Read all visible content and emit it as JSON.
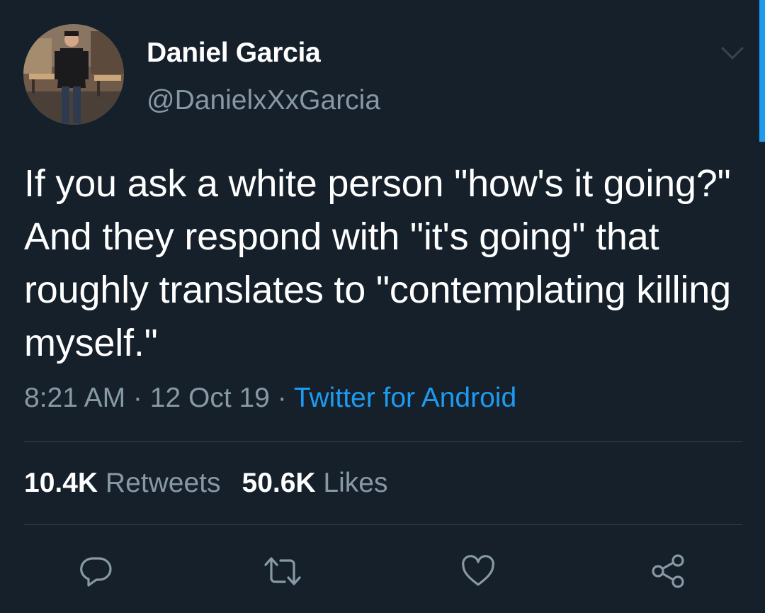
{
  "tweet": {
    "author": {
      "display_name": "Daniel Garcia",
      "handle": "@DanielxXxGarcia"
    },
    "text": "If you ask a white person \"how's it going?\" And they respond with \"it's going\" that roughly translates to \"contemplating killing myself.\"",
    "time": "8:21 AM",
    "separator": " · ",
    "date": "12 Oct 19",
    "source": "Twitter for Android",
    "stats": {
      "retweets_count": "10.4K",
      "retweets_label": "Retweets",
      "likes_count": "50.6K",
      "likes_label": "Likes"
    }
  },
  "actions": [
    {
      "icon": "reply-icon"
    },
    {
      "icon": "retweet-icon"
    },
    {
      "icon": "like-icon"
    },
    {
      "icon": "share-icon"
    }
  ],
  "colors": {
    "background": "#15202b",
    "primary_text": "#ffffff",
    "secondary_text": "#8899a6",
    "accent": "#1d9bf0",
    "divider": "#38444d"
  }
}
